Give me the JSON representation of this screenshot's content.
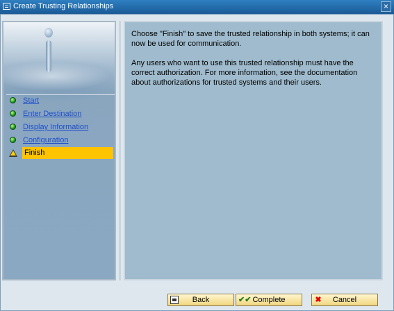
{
  "window": {
    "title": "Create Trusting Relationships",
    "close_icon": "×"
  },
  "steps": [
    {
      "label": "Start",
      "status": "done"
    },
    {
      "label": "Enter Destination",
      "status": "done"
    },
    {
      "label": "Display Information",
      "status": "done"
    },
    {
      "label": "Configuration",
      "status": "done"
    },
    {
      "label": "Finish",
      "status": "current"
    }
  ],
  "content": {
    "paragraph1": "Choose \"Finish\" to save the trusted relationship in both systems; it can now be used for communication.",
    "paragraph2": "Any users who want to use this trusted relationship must have the correct authorization. For more information, see the documentation about authorizations for trusted systems and their users."
  },
  "buttons": {
    "back": {
      "label": "Back",
      "icon": "back-icon"
    },
    "complete": {
      "label": "Complete",
      "icon": "double-check-icon",
      "glyph": "✔✔"
    },
    "cancel": {
      "label": "Cancel",
      "icon": "cancel-x-icon",
      "glyph": "✖"
    }
  },
  "colors": {
    "titlebar": "#1f69ad",
    "active_step": "#ffc300",
    "link": "#1f4ec9",
    "content_bg": "#9fbbcd"
  }
}
